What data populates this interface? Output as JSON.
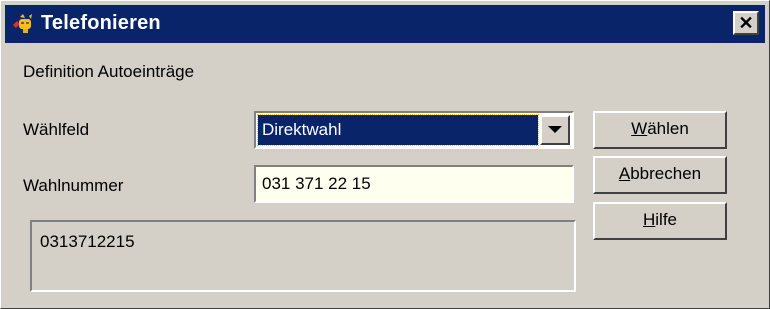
{
  "window": {
    "title": "Telefonieren",
    "close_glyph": "✕",
    "icon": "telephone-app-icon"
  },
  "section_label": "Definition Autoeinträge",
  "fields": {
    "waehlfeld": {
      "label": "Wählfeld",
      "selected_value": "Direktwahl"
    },
    "wahlnummer": {
      "label": "Wahlnummer",
      "value": "031 371 22 15"
    }
  },
  "display_number": "0313712215",
  "buttons": {
    "waehlen": {
      "accel": "W",
      "rest": "ählen"
    },
    "abbrechen": {
      "accel": "A",
      "rest": "bbrechen"
    },
    "hilfe": {
      "accel": "H",
      "rest": "ilfe"
    }
  },
  "colors": {
    "titlebar": "#0a246a",
    "face": "#d4d0c8",
    "selection": "#0a246a",
    "input_bg": "#fffff0"
  }
}
